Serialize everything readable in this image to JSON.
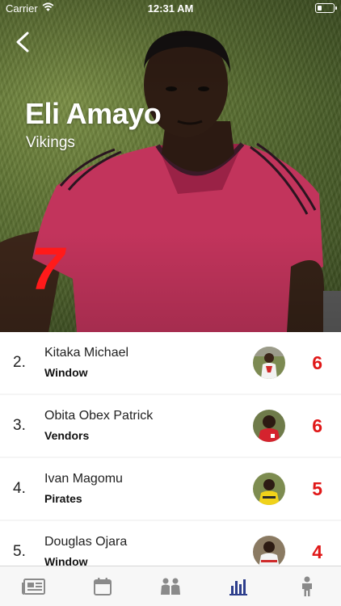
{
  "status_bar": {
    "carrier": "Carrier",
    "time": "12:31 AM"
  },
  "header": {
    "player_name": "Eli Amayo",
    "team": "Vikings",
    "score": "7",
    "back_icon": "chevron-left-icon"
  },
  "rankings": [
    {
      "rank": "2.",
      "name": "Kitaka Michael",
      "team": "Window",
      "score": "6"
    },
    {
      "rank": "3.",
      "name": "Obita Obex Patrick",
      "team": "Vendors",
      "score": "6"
    },
    {
      "rank": "4.",
      "name": "Ivan Magomu",
      "team": "Pirates",
      "score": "5"
    },
    {
      "rank": "5.",
      "name": "Douglas Ojara",
      "team": "Window",
      "score": "4"
    }
  ],
  "tabs": [
    {
      "icon": "newspaper-icon",
      "active": false
    },
    {
      "icon": "calendar-icon",
      "active": false
    },
    {
      "icon": "team-icon",
      "active": false
    },
    {
      "icon": "bar-chart-icon",
      "active": true
    },
    {
      "icon": "person-icon",
      "active": false
    }
  ],
  "colors": {
    "score_red": "#e01818",
    "tab_inactive": "#8a8a8a",
    "tab_active": "#2d3e8c",
    "jersey_pink": "#c8325a"
  }
}
